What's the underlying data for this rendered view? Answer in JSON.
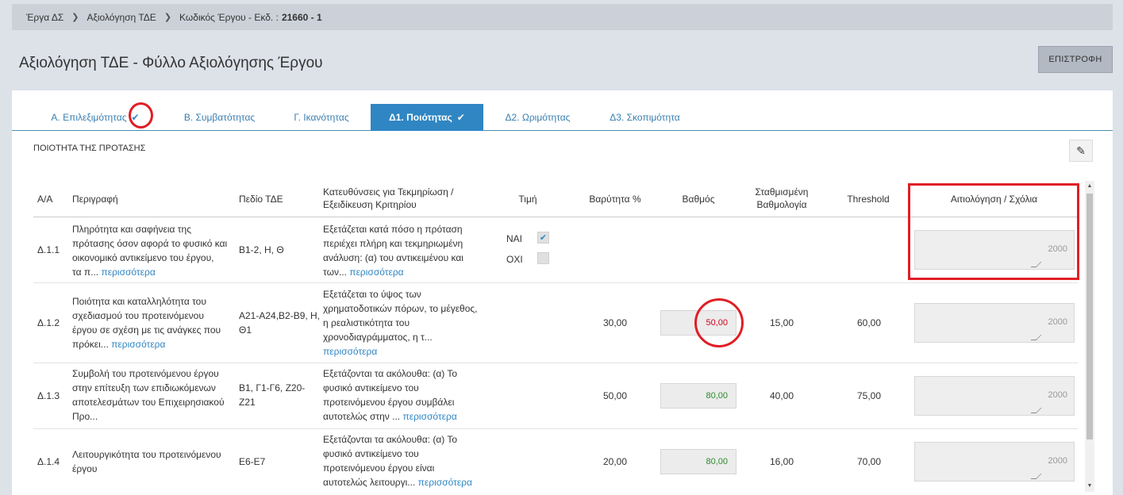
{
  "breadcrumb": {
    "item1": "Έργα ΔΣ",
    "item2": "Αξιολόγηση ΤΔΕ",
    "item3_prefix": "Κωδικός Έργου - Εκδ. :",
    "item3_code": "21660 - 1"
  },
  "page_title": "Αξιολόγηση ΤΔΕ - Φύλλο Αξιολόγησης Έργου",
  "back_button": "ΕΠΙΣΤΡΟΦΗ",
  "tabs": [
    {
      "label": "Α. Επιλεξιμότητας",
      "checked": true,
      "active": false
    },
    {
      "label": "Β. Συμβατότητας",
      "checked": false,
      "active": false
    },
    {
      "label": "Γ. Ικανότητας",
      "checked": false,
      "active": false
    },
    {
      "label": "Δ1. Ποιότητας",
      "checked": true,
      "active": true
    },
    {
      "label": "Δ2. Ωριμότητας",
      "checked": false,
      "active": false
    },
    {
      "label": "Δ3. Σκοπιμότητα",
      "checked": false,
      "active": false
    }
  ],
  "section_title": "ΠΟΙΟΤΗΤΑ ΤΗΣ ΠΡΟΤΑΣΗΣ",
  "columns": {
    "aa": "Α/Α",
    "desc": "Περιγραφή",
    "field": "Πεδίο ΤΔΕ",
    "guide_line1": "Κατευθύνσεις για Τεκμηρίωση /",
    "guide_line2": "Εξειδίκευση Κριτηρίου",
    "value": "Τιμή",
    "weight": "Βαρύτητα %",
    "score": "Βαθμός",
    "weighted_line1": "Σταθμισμένη",
    "weighted_line2": "Βαθμολογία",
    "threshold": "Threshold",
    "comments": "Αιτιολόγηση / Σχόλια"
  },
  "more_label": "περισσότερα",
  "rows": [
    {
      "aa": "Δ.1.1",
      "desc": [
        "Πληρότητα και σαφήνεια της",
        "πρότασης όσον αφορά το φυσικό και",
        "οικονομικό αντικείμενο του έργου,",
        "τα π..."
      ],
      "field": [
        "Β1-2, Η, Θ"
      ],
      "guide": [
        "Εξετάζεται κατά πόσο η πρόταση",
        "περιέχει πλήρη και τεκμηριωμένη",
        "ανάλυση: (α) του αντικειμένου και",
        "των..."
      ],
      "value_yes": "ΝΑΙ",
      "value_no": "ΟΧΙ",
      "yes_checked": true,
      "weight": "",
      "score": "",
      "weighted": "",
      "threshold": "",
      "counter": "2000"
    },
    {
      "aa": "Δ.1.2",
      "desc": [
        "Ποιότητα και καταλληλότητα του",
        "σχεδιασμού του προτεινόμενου",
        "έργου σε σχέση με τις ανάγκες που",
        "πρόκει..."
      ],
      "field": [
        "Α21-Α24,Β2-Β9, Η,",
        "Θ1"
      ],
      "guide": [
        "Εξετάζεται το ύψος των",
        "χρηματοδοτικών πόρων, το μέγεθος,",
        "η ρεαλιστικότητα του",
        "χρονοδιαγράμματος, η τ...",
        ""
      ],
      "weight": "30,00",
      "score": "50,00",
      "score_color": "#d0021b",
      "weighted": "15,00",
      "threshold": "60,00",
      "counter": "2000"
    },
    {
      "aa": "Δ.1.3",
      "desc": [
        "Συμβολή του προτεινόμενου έργου",
        "στην επίτευξη των επιδιωκόμενων",
        "αποτελεσμάτων του Επιχειρησιακού",
        "Προ..."
      ],
      "field": [
        "Β1, Γ1-Γ6, Ζ20-",
        "Ζ21"
      ],
      "guide": [
        "Εξετάζονται τα ακόλουθα: (α) Το",
        "φυσικό αντικείμενο του",
        "προτεινόμενου έργου συμβάλει",
        "αυτοτελώς στην ..."
      ],
      "weight": "50,00",
      "score": "80,00",
      "score_color": "#2e8b2e",
      "weighted": "40,00",
      "threshold": "75,00",
      "counter": "2000"
    },
    {
      "aa": "Δ.1.4",
      "desc": [
        "Λειτουργικότητα του προτεινόμενου",
        "έργου"
      ],
      "field": [
        "Ε6-Ε7"
      ],
      "guide": [
        "Εξετάζονται τα ακόλουθα: (α) Το",
        "φυσικό αντικείμενο του",
        "προτεινόμενου έργου είναι",
        "αυτοτελώς λειτουργι..."
      ],
      "weight": "20,00",
      "score": "80,00",
      "score_color": "#2e8b2e",
      "weighted": "16,00",
      "threshold": "70,00",
      "counter": "2000"
    }
  ],
  "icons": {
    "check": "check-icon",
    "edit": "pencil-icon",
    "breadcrumb_sep": "chevron-right-icon"
  }
}
